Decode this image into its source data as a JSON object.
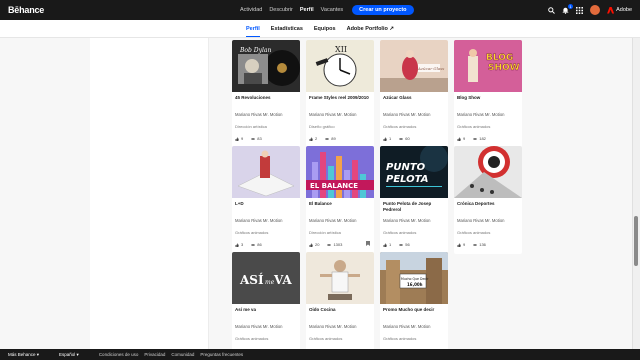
{
  "header": {
    "logo": "Bēhance",
    "nav": [
      {
        "label": "Actividad"
      },
      {
        "label": "Descubrir"
      },
      {
        "label": "Perfil",
        "active": true
      },
      {
        "label": "Vacantes"
      }
    ],
    "create_button": "Crear un proyecto",
    "notification_count": "1",
    "adobe_label": "Adobe",
    "icons": [
      "search-icon",
      "bell-icon",
      "grid-apps-icon",
      "avatar"
    ]
  },
  "subnav": {
    "tabs": [
      {
        "label": "Perfil",
        "active": true
      },
      {
        "label": "Estadísticas"
      },
      {
        "label": "Equipos"
      },
      {
        "label": "Adobe Portfolio ↗"
      }
    ]
  },
  "projects": [
    {
      "title": "45 Revoluciones",
      "owner": "Mariano Rivas Mr. Motion",
      "field": "Dirección artística",
      "likes": "9",
      "views": "83",
      "thumb_color": "#2b2b2b"
    },
    {
      "title": "Frame Styles reel 2009/2010",
      "owner": "Mariano Rivas Mr. Motion",
      "field": "Diseño gráfico",
      "likes": "2",
      "views": "89",
      "thumb_color": "#eeeada"
    },
    {
      "title": "Azúcar Glass",
      "owner": "Mariano Rivas Mr. Motion",
      "field": "Gráficos animados",
      "likes": "1",
      "views": "60",
      "thumb_color": "#e8d3c3"
    },
    {
      "title": "Blog Show",
      "owner": "Mariano Rivas Mr. Motion",
      "field": "Gráficos animados",
      "likes": "9",
      "views": "182",
      "thumb_color": "#c94a8b"
    },
    {
      "title": "L+D",
      "owner": "Mariano Rivas Mr. Motion",
      "field": "Gráficos animados",
      "likes": "3",
      "views": "86",
      "thumb_color": "#d9d4ea"
    },
    {
      "title": "El Balance",
      "owner": "Mariano Rivas Mr. Motion",
      "field": "Dirección artística",
      "likes": "20",
      "views": "1303",
      "thumb_color": "#7d6fd9",
      "featured": true
    },
    {
      "title": "Punto Pelota de Josep Pedrerol",
      "owner": "Mariano Rivas Mr. Motion",
      "field": "Gráficos animados",
      "likes": "1",
      "views": "56",
      "thumb_color": "#0f1c25"
    },
    {
      "title": "Crónica Deportes",
      "owner": "Mariano Rivas Mr. Motion",
      "field": "Gráficos animados",
      "likes": "9",
      "views": "136",
      "thumb_color": "#e8e8e8"
    },
    {
      "title": "Así me va",
      "owner": "Mariano Rivas Mr. Motion",
      "field": "Gráficos animados",
      "likes": "2",
      "views": "80",
      "thumb_color": "#4a4a4a"
    },
    {
      "title": "Oido Cocina",
      "owner": "Mariano Rivas Mr. Motion",
      "field": "Gráficos animados",
      "likes": "4",
      "views": "102",
      "thumb_color": "#efe8dc"
    },
    {
      "title": "Promo Mucho que decir",
      "owner": "Mariano Rivas Mr. Motion",
      "field": "Gráficos animados",
      "likes": "1",
      "views": "70",
      "thumb_color": "#9e7c55"
    }
  ],
  "thumb_text": {
    "p0": "Bob Dylan",
    "p1": "XII",
    "p2": "Azúcar Glass",
    "p3a": "BLOG",
    "p3b": "SHOW",
    "p5": "EL BALANCE",
    "p6a": "PUNTO",
    "p6b": "PELOTA",
    "p8a": "ASÍ",
    "p8b": "me",
    "p8c": "VA",
    "p10a": "Mucho Que Decir",
    "p10b": "16,00h"
  },
  "footer": {
    "more": "Más Behance ▾",
    "language": "Español ▾",
    "links": [
      "Condiciones de uso",
      "Privacidad",
      "Comunidad",
      "Preguntas frecuentes"
    ]
  },
  "colors": {
    "accent": "#0057ff",
    "topbar": "#191919",
    "adobe_red": "#fa0f00"
  }
}
